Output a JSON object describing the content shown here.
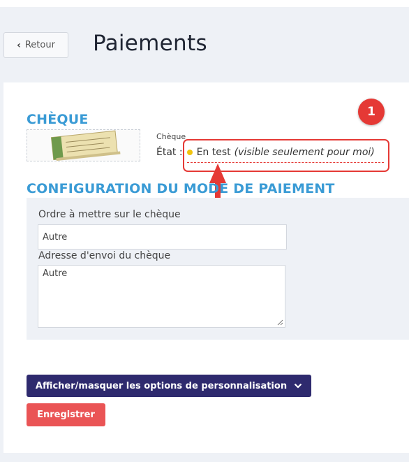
{
  "header": {
    "back_label": "Retour",
    "title": "Paiements"
  },
  "cheque_section": {
    "title": "CHÈQUE",
    "mini_label": "Chèque",
    "state_label": "État :",
    "state_value": "En test",
    "state_note": "(visible seulement pour moi)",
    "state_color": "#f1c40f"
  },
  "annotation": {
    "badge_number": "1",
    "color": "#e53935"
  },
  "config_section": {
    "title": "CONFIGURATION DU MODE DE PAIEMENT",
    "order_label": "Ordre à mettre sur le chèque",
    "order_value": "Autre",
    "address_label": "Adresse d'envoi du chèque",
    "address_value": "Autre"
  },
  "actions": {
    "toggle_label": "Afficher/masquer les options de personnalisation",
    "save_label": "Enregistrer"
  },
  "colors": {
    "accent_blue": "#3a9bd5",
    "primary_dark": "#2e2a6e",
    "danger": "#ea5455"
  }
}
